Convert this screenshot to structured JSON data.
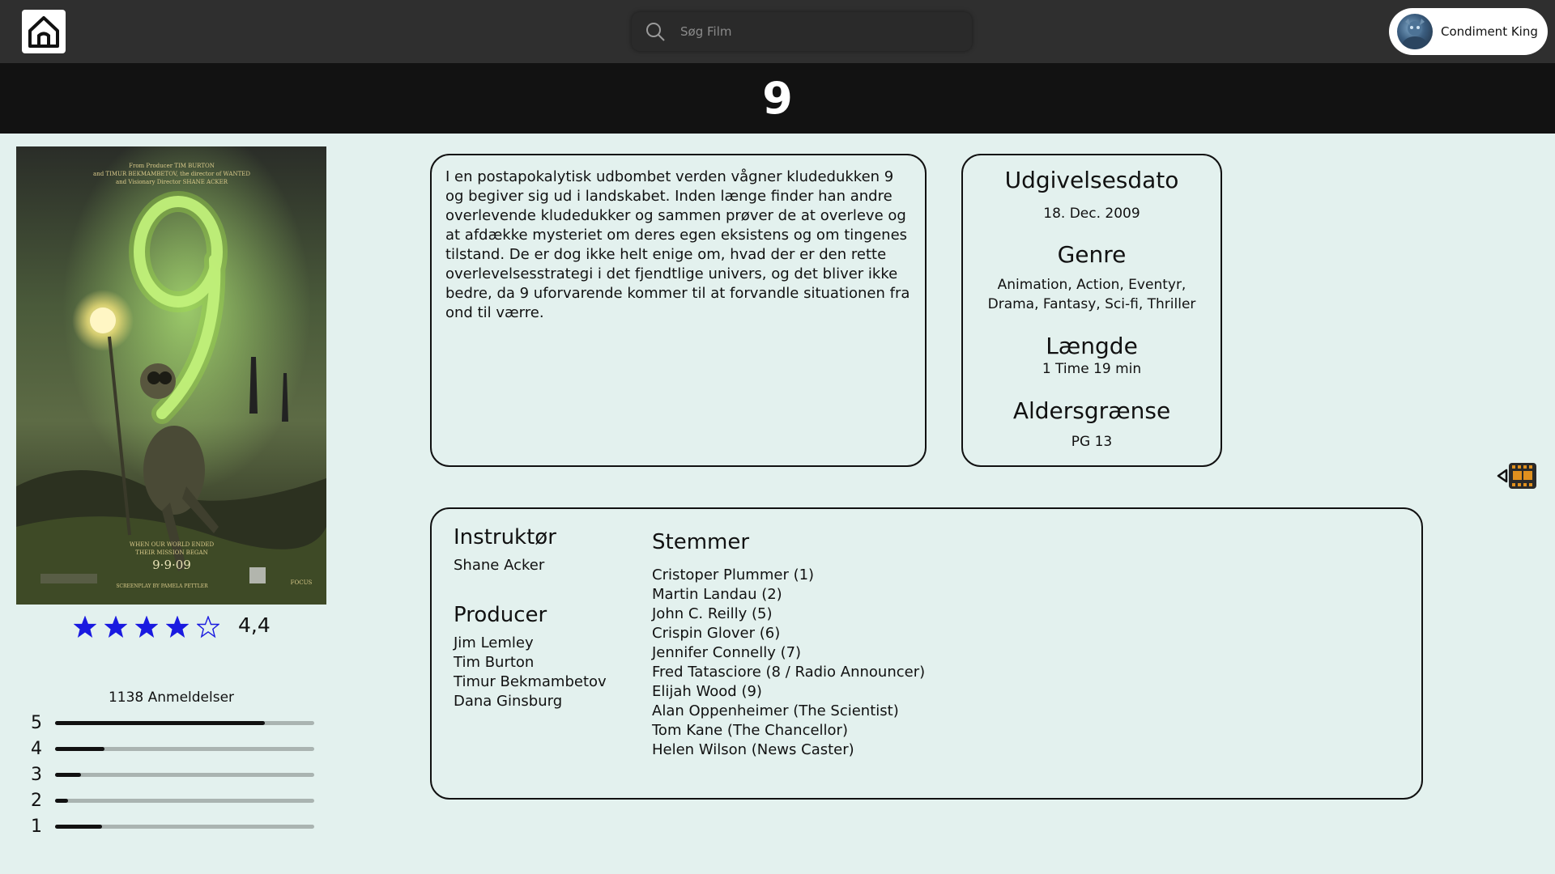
{
  "header": {
    "home_icon": "home-icon",
    "search": {
      "placeholder": "Søg Film",
      "icon": "search-icon"
    },
    "user": {
      "name": "Condiment King"
    }
  },
  "movie": {
    "title": "9",
    "poster": {
      "top_credit_lines": [
        "From Producer TIM BURTON",
        "and TIMUR BEKMAMBETOV, the director of WANTED",
        "and Visionary Director SHANE ACKER"
      ],
      "big_numeral": "9",
      "tagline_lines": [
        "WHEN OUR WORLD ENDED",
        "THEIR MISSION BEGAN"
      ],
      "date": "9·9·09",
      "bottom_credit": "SCREENPLAY BY PAMELA PETTLER",
      "studio": "FOCUS"
    },
    "rating": {
      "value_text": "4,4",
      "filled_stars": 4,
      "total_stars": 5,
      "color": "#1a1ae0"
    },
    "reviews_label": "1138 Anmeldelser",
    "distribution": [
      {
        "label": "5",
        "fraction": 0.81
      },
      {
        "label": "4",
        "fraction": 0.19
      },
      {
        "label": "3",
        "fraction": 0.1
      },
      {
        "label": "2",
        "fraction": 0.05
      },
      {
        "label": "1",
        "fraction": 0.18
      }
    ],
    "description": "I en postapokalytisk udbombet verden vågner kludedukken 9 og begiver sig ud i landskabet. Inden længe finder han andre overlevende kludedukker og sammen prøver de at overleve og at afdække mysteriet om deres egen eksistens og om tingenes tilstand. De er dog ikke helt enige om, hvad der er den rette overlevelsesstrategi i det fjendtlige univers, og det bliver ikke bedre, da 9 uforvarende kommer til at forvandle situationen fra ond til værre.",
    "facts": {
      "release_heading": "Udgivelsesdato",
      "release_value": "18. Dec. 2009",
      "genre_heading": "Genre",
      "genre_value": "Animation, Action, Eventyr, Drama, Fantasy, Sci-fi, Thriller",
      "length_heading": "Længde",
      "length_value": "1 Time 19 min",
      "age_heading": "Aldersgrænse",
      "age_value": "PG 13"
    },
    "credits": {
      "director_heading": "Instruktør",
      "director": "Shane Acker",
      "producer_heading": "Producer",
      "producers": [
        "Jim Lemley",
        "Tim Burton",
        "Timur Bekmambetov",
        "Dana Ginsburg"
      ],
      "voices_heading": "Stemmer",
      "voices": [
        "Cristoper Plummer (1)",
        "Martin Landau (2)",
        "John C. Reilly (5)",
        "Crispin Glover (6)",
        "Jennifer Connelly (7)",
        "Fred Tatasciore (8 / Radio Announcer)",
        "Elijah Wood (9)",
        "Alan Oppenheimer (The Scientist)",
        "Tom Kane (The Chancellor)",
        "Helen Wilson (News Caster)"
      ]
    },
    "trailer_icon": "film-trailer-icon"
  }
}
